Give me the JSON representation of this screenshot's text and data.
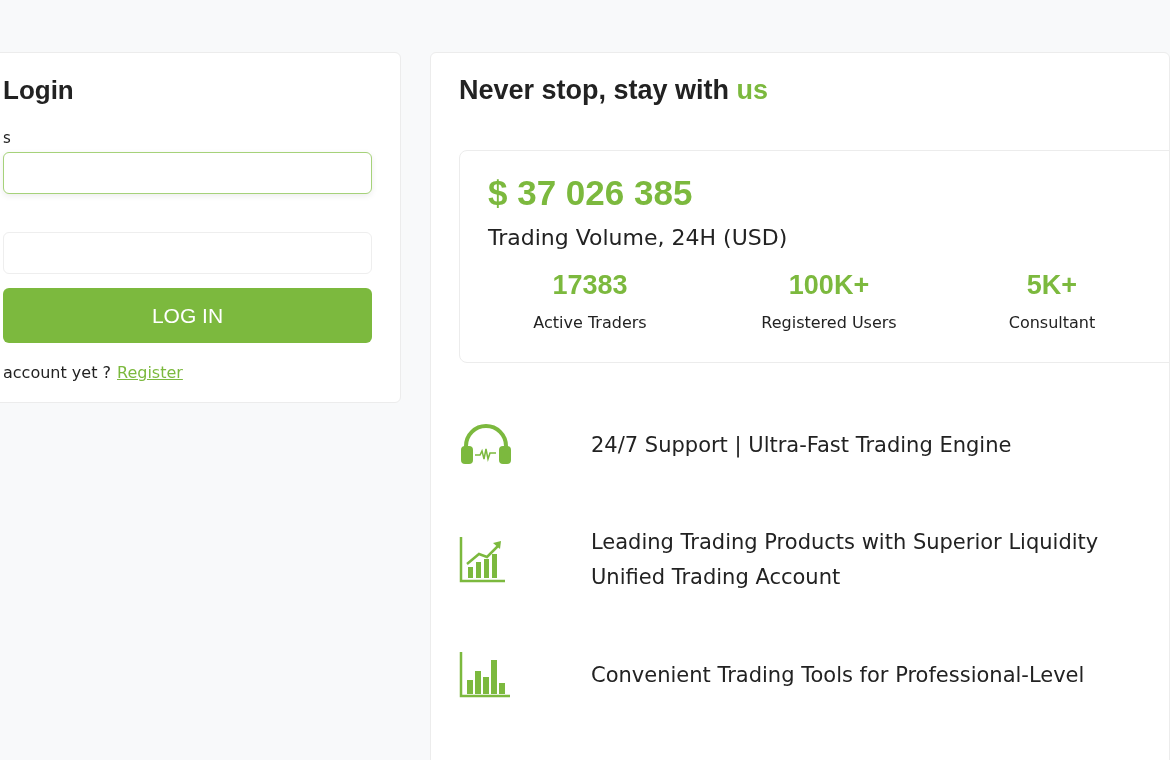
{
  "login": {
    "title": "Login",
    "fields": [
      {
        "label": "s",
        "focused": true
      },
      {
        "focused": false
      }
    ],
    "button": "LOG IN",
    "footer_text": "account yet ?",
    "footer_link": "Register"
  },
  "promo": {
    "heading": "Never stop, stay with",
    "heading_highlight": "us",
    "volume": {
      "amount": "$ 37 026 385",
      "label": "Trading Volume, 24H (USD)"
    },
    "stats": [
      {
        "value": "17383",
        "label": "Active Traders"
      },
      {
        "value": "100K+",
        "label": "Registered Users"
      },
      {
        "value": "5K+",
        "label": "Consultant"
      }
    ],
    "features": [
      {
        "kind": "headphones",
        "lines": [
          "24/7 Support | Ultra-Fast Trading Engine"
        ]
      },
      {
        "kind": "growth-chart",
        "lines": [
          "Leading Trading Products with Superior Liquidity",
          "Unified Trading Account"
        ]
      },
      {
        "kind": "bar-chart",
        "lines": [
          "Convenient Trading Tools for Professional-Level"
        ]
      }
    ]
  }
}
